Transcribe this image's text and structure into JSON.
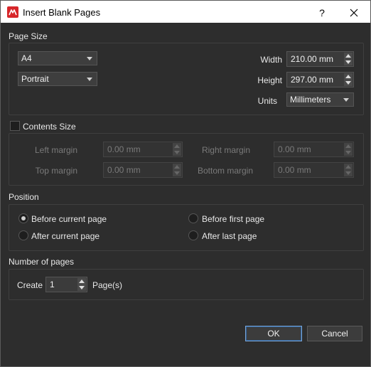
{
  "window": {
    "title": "Insert Blank Pages",
    "help": "?"
  },
  "page_size": {
    "section": "Page Size",
    "size_value": "A4",
    "orientation_value": "Portrait",
    "width_label": "Width",
    "width_value": "210.00 mm",
    "height_label": "Height",
    "height_value": "297.00 mm",
    "units_label": "Units",
    "units_value": "Millimeters"
  },
  "contents_size": {
    "label": "Contents Size",
    "checked": false,
    "left_margin_label": "Left margin",
    "left_margin_value": "0.00 mm",
    "right_margin_label": "Right margin",
    "right_margin_value": "0.00 mm",
    "top_margin_label": "Top margin",
    "top_margin_value": "0.00 mm",
    "bottom_margin_label": "Bottom margin",
    "bottom_margin_value": "0.00 mm"
  },
  "position": {
    "section": "Position",
    "selected": "before_current",
    "before_current": "Before current page",
    "after_current": "After current page",
    "before_first": "Before first page",
    "after_last": "After last page"
  },
  "number_of_pages": {
    "section": "Number of pages",
    "create_label": "Create",
    "count": "1",
    "suffix": "Page(s)"
  },
  "buttons": {
    "ok": "OK",
    "cancel": "Cancel"
  },
  "colors": {
    "accent": "#d7262a",
    "background": "#2d2d2d",
    "default_button_border": "#7aa5d6"
  }
}
